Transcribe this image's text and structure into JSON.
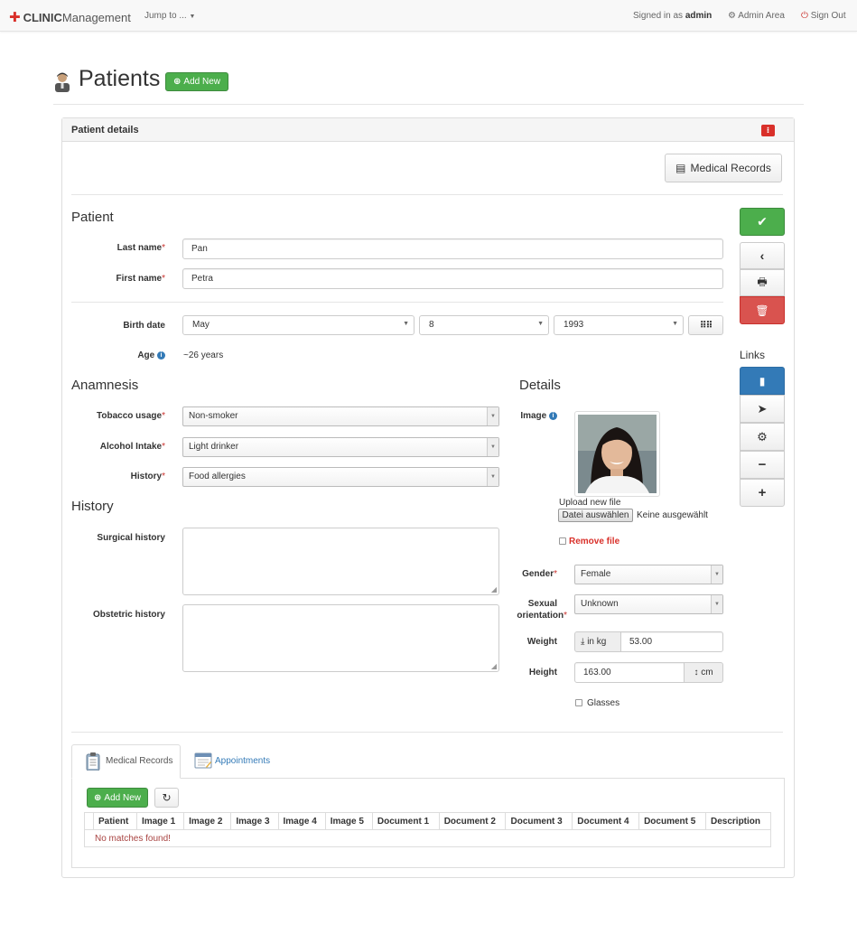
{
  "nav": {
    "brand_bold": "CLINIC",
    "brand_rest": "Management",
    "jump": "Jump to ...",
    "signed_prefix": "Signed in as",
    "user": "admin",
    "admin_area": "Admin Area",
    "sign_out": "Sign Out"
  },
  "header": {
    "title": "Patients",
    "add_new": "Add New"
  },
  "panel": {
    "title": "Patient details",
    "medical_records_button": "Medical Records"
  },
  "patient": {
    "heading": "Patient",
    "last_name_label": "Last name",
    "last_name": "Pan",
    "first_name_label": "First name",
    "first_name": "Petra",
    "birth_label": "Birth date",
    "birth_month": "May",
    "birth_day": "8",
    "birth_year": "1993",
    "age_label": "Age",
    "age_value": "~26 years"
  },
  "anamnesis": {
    "heading": "Anamnesis",
    "tobacco_label": "Tobacco usage",
    "tobacco": "Non-smoker",
    "alcohol_label": "Alcohol Intake",
    "alcohol": "Light drinker",
    "history_label": "History",
    "history": "Food allergies"
  },
  "history": {
    "heading": "History",
    "surgical_label": "Surgical history",
    "obstetric_label": "Obstetric history"
  },
  "details": {
    "heading": "Details",
    "image_label": "Image",
    "upload_label": "Upload new file",
    "choose_file": "Datei auswählen",
    "no_file": "Keine ausgewählt",
    "remove_file": "Remove file",
    "gender_label": "Gender",
    "gender": "Female",
    "sexual_label_1": "Sexual",
    "sexual_label_2": "orientation",
    "sexual": "Unknown",
    "weight_label": "Weight",
    "weight_unit": "in kg",
    "weight": "53.00",
    "height_label": "Height",
    "height": "163.00",
    "height_unit": "cm",
    "glasses_label": "Glasses"
  },
  "sidebar": {
    "links_heading": "Links"
  },
  "tabs": {
    "medical_records": "Medical Records",
    "appointments": "Appointments"
  },
  "records": {
    "add_new": "Add New",
    "columns": [
      "Patient",
      "Image 1",
      "Image 2",
      "Image 3",
      "Image 4",
      "Image 5",
      "Document 1",
      "Document 2",
      "Document 3",
      "Document 4",
      "Document 5",
      "Description"
    ],
    "empty": "No matches found!"
  },
  "icons": {
    "brand": "plus-icon",
    "jump": "caret-down-icon",
    "admin": "gear-icon",
    "signout": "power-icon",
    "patients": "user-icon",
    "save": "check-icon",
    "back": "chevron-left-icon",
    "print": "print-icon",
    "delete": "trash-icon",
    "links": [
      "file-icon",
      "send-icon",
      "gear-icon",
      "minus-icon",
      "plus-icon"
    ]
  },
  "colors": {
    "success": "#4cae4c",
    "danger": "#d9534f",
    "primary": "#337ab7",
    "required": "#c9302c"
  }
}
